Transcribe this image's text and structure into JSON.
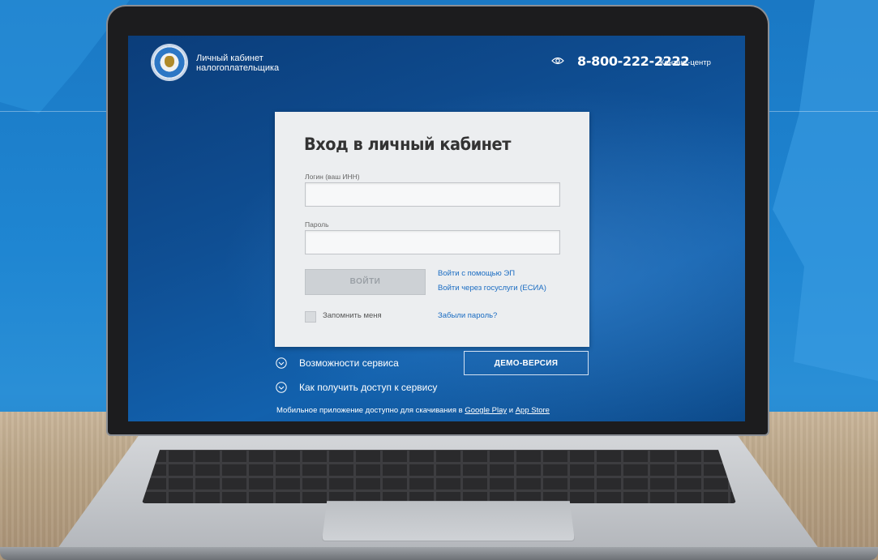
{
  "header": {
    "title_line1": "Личный кабинет",
    "title_line2": "налогоплательщика",
    "phone": "8-800-222-2222",
    "contact_label": "Контакт-центр"
  },
  "login": {
    "title": "Вход в личный кабинет",
    "login_label": "Логин (ваш ИНН)",
    "login_value": "",
    "password_label": "Пароль",
    "password_value": "",
    "submit_label": "ВОЙТИ",
    "ep_link": "Войти с помощью ЭП",
    "gosuslugi_link": "Войти через госуслуги (ЕСИА)",
    "remember_label": "Запомнить меня",
    "forgot_link": "Забыли пароль?"
  },
  "footer": {
    "features_link": "Возможности сервиса",
    "access_link": "Как получить доступ к сервису",
    "demo_button": "ДЕМО-ВЕРСИЯ",
    "mobile_text": "Мобильное приложение доступно для скачивания в",
    "google_play": "Google Play",
    "and": "и",
    "app_store": "App Store"
  },
  "colors": {
    "screen_bg": "#0f4f94",
    "link": "#1a6cc2",
    "card_bg": "#eceef0"
  }
}
